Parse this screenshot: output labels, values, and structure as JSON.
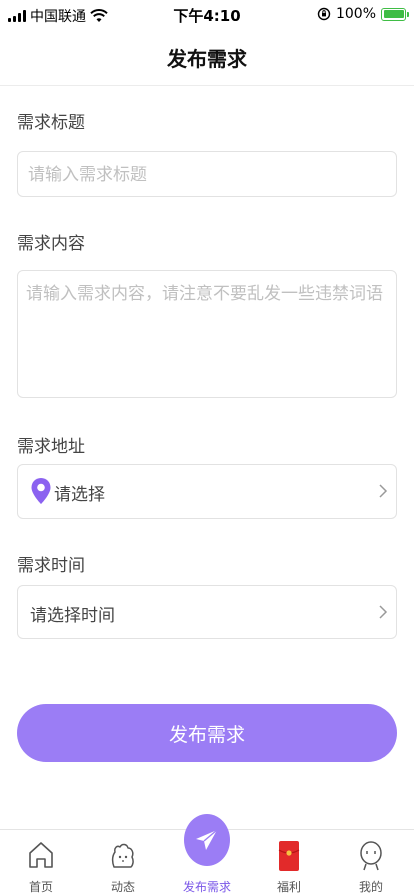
{
  "status_bar": {
    "carrier": "中国联通",
    "time": "下午4:10",
    "battery": "100%"
  },
  "nav": {
    "title": "发布需求"
  },
  "form": {
    "title_label": "需求标题",
    "title_placeholder": "请输入需求标题",
    "content_label": "需求内容",
    "content_placeholder": "请输入需求内容，请注意不要乱发一些违禁词语",
    "address_label": "需求地址",
    "address_value": "请选择",
    "time_label": "需求时间",
    "time_value": "请选择时间"
  },
  "submit": {
    "label": "发布需求"
  },
  "tabs": [
    {
      "label": "首页",
      "icon": "home-icon"
    },
    {
      "label": "动态",
      "icon": "feed-icon"
    },
    {
      "label": "发布需求",
      "icon": "paper-plane-icon",
      "active": true
    },
    {
      "label": "福利",
      "icon": "red-packet-icon"
    },
    {
      "label": "我的",
      "icon": "profile-icon"
    }
  ],
  "colors": {
    "accent": "#9b7df5",
    "accent_dark": "#7a57e8",
    "battery": "#3fbd45",
    "red_packet": "#e22a2a"
  }
}
